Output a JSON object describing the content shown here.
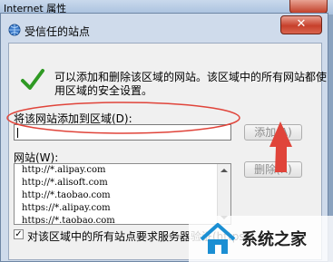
{
  "parent_window": {
    "title": "Internet 属性"
  },
  "dialog": {
    "title": "受信任的站点",
    "close_label": "✕",
    "info_text": "可以添加和删除该区域的网站。该区域中的所有网站都使用区域的安全设置。",
    "add_label": "将该网站添加到区域(D):",
    "add_input_value": "",
    "add_button": "添加(A)",
    "websites_label": "网站(W):",
    "remove_button": "删除(R)",
    "websites": [
      "http://*.alipay.com",
      "http://*.alisoft.com",
      "http://*.taobao.com",
      "https://*.alipay.com",
      "https://*.taobao.com"
    ],
    "require_https_label": "对该区域中的所有站点要求服务器验证(https:)",
    "require_https_checked": true
  },
  "watermark": {
    "text": "系统之家"
  },
  "colors": {
    "annotation": "#e0443a",
    "check": "#2f9a24"
  }
}
